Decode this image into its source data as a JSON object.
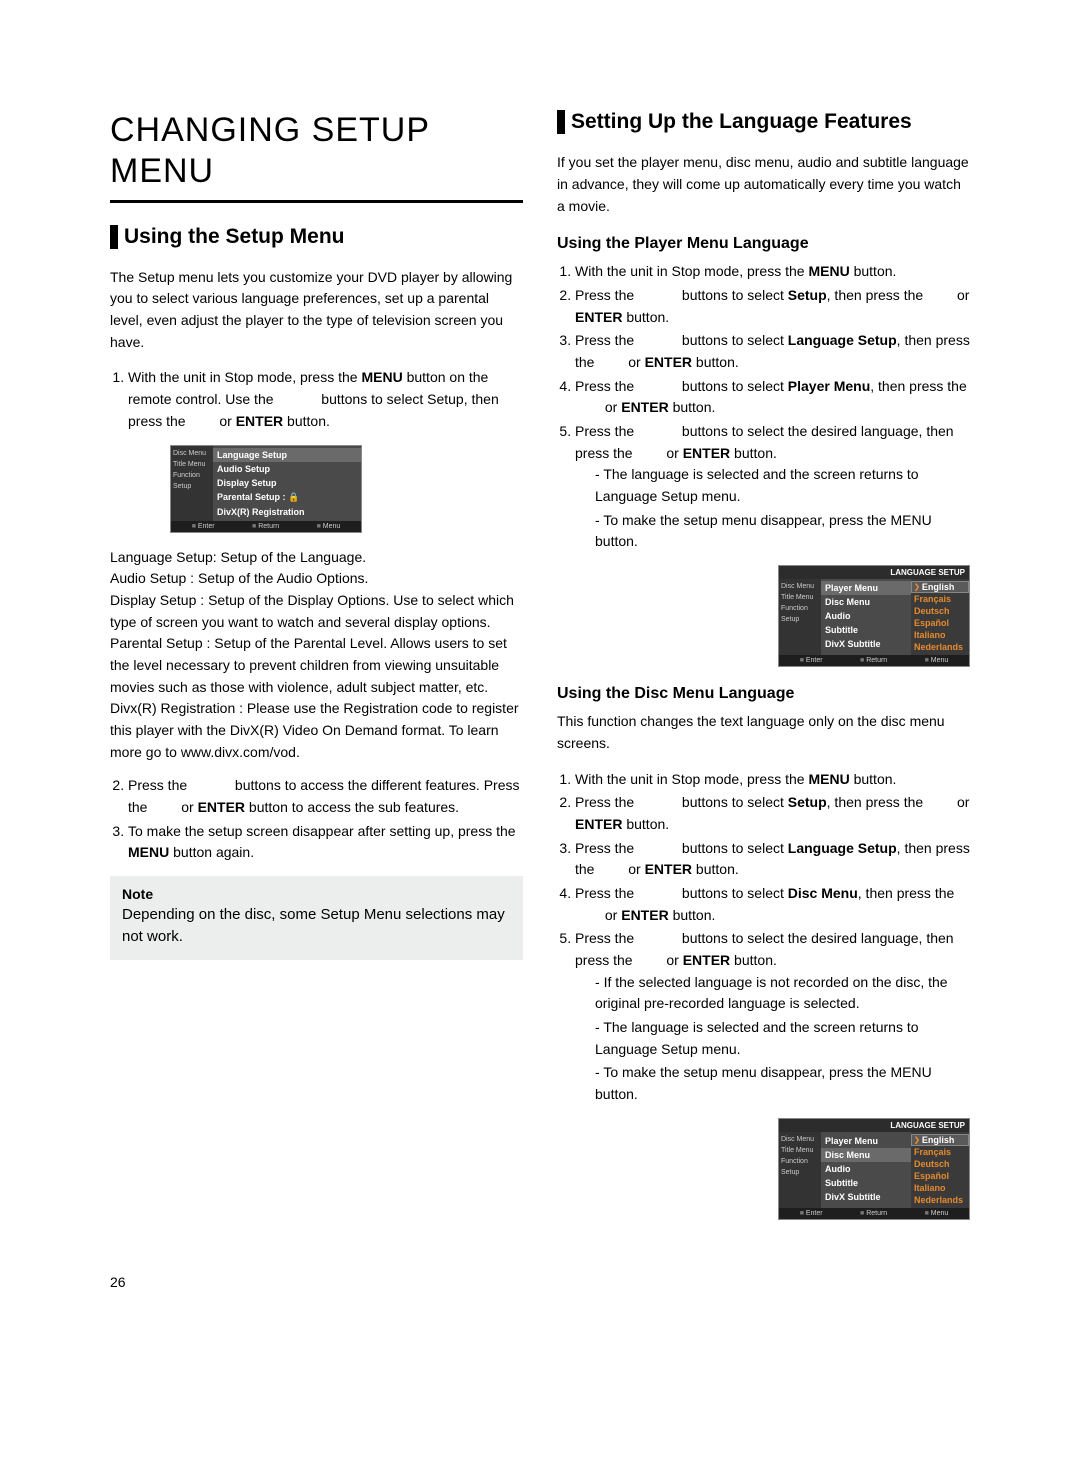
{
  "page_number": "26",
  "left": {
    "main_title": "CHANGING SETUP MENU",
    "section_heading": "Using the Setup Menu",
    "intro": "The Setup menu lets you customize your DVD player by allowing you to select various language preferences, set up a parental level, even adjust the player to the type of television screen you have.",
    "step1_a": "With the unit in Stop mode, press the ",
    "step1_menu": "MENU",
    "step1_b": " button on the remote control.  Use the ",
    "step1_c": " buttons to select Setup, then press the ",
    "step1_d": " or ",
    "step1_enter": "ENTER",
    "step1_e": " button.",
    "osd1": {
      "side": [
        "Disc Menu",
        "Title Menu",
        "Function",
        "Setup"
      ],
      "items": [
        "Language Setup",
        "Audio Setup",
        "Display Setup",
        "Parental Setup :   🔒",
        "DivX(R) Registration"
      ],
      "footer": [
        "Enter",
        "Return",
        "Menu"
      ]
    },
    "defs": {
      "lang_label": "Language Setup: ",
      "lang_body": "Setup of the Language.",
      "audio_label": "Audio Setup : ",
      "audio_body": "Setup of the Audio Options.",
      "display_label": "Display Setup : ",
      "display_body": "Setup of the Display Options. Use to select which type of screen you want to watch and several display options.",
      "parental_label": "Parental Setup : ",
      "parental_body": "Setup of the Parental Level. Allows users to set the level necessary to prevent children from viewing unsuitable movies such as those with violence, adult subject matter, etc.",
      "divx_label": "Divx(R) Registration : ",
      "divx_body": "Please use the Registration code to register this player with the DivX(R) Video On Demand format. To learn more go to www.divx.com/vod."
    },
    "step2_a": "Press the ",
    "step2_b": " buttons to access the different  features. Press the ",
    "step2_c": " or ",
    "step2_enter": "ENTER",
    "step2_d": " button to access the sub features.",
    "step3_a": "To make the setup screen disappear after setting up, press the ",
    "step3_menu": "MENU",
    "step3_b": " button again.",
    "note_title": "Note",
    "note_body": "Depending on the disc, some Setup Menu selections may not work."
  },
  "right": {
    "section_heading": "Setting Up the Language Features",
    "intro": "If you set the player menu, disc menu, audio and subtitle language in advance, they will come up automatically every time you watch a movie.",
    "sub1_heading": "Using the Player Menu Language",
    "s1_1a": "With the unit in Stop mode, press the ",
    "s1_1menu": "MENU",
    "s1_1b": " button.",
    "s1_2a": "Press the ",
    "s1_2b": " buttons to select ",
    "s1_2setup": "Setup",
    "s1_2c": ", then press the ",
    "s1_2d": " or ",
    "s1_2enter": "ENTER",
    "s1_2e": " button.",
    "s1_3a": "Press the ",
    "s1_3b": " buttons to select ",
    "s1_3ls": "Language Setup",
    "s1_3c": ", then press the ",
    "s1_3d": " or ",
    "s1_3enter": "ENTER",
    "s1_3e": " button.",
    "s1_4a": "Press the ",
    "s1_4b": " buttons to select ",
    "s1_4pm": "Player Menu",
    "s1_4c": ", then press the ",
    "s1_4d": " or ",
    "s1_4enter": "ENTER",
    "s1_4e": " button.",
    "s1_5a": "Press the ",
    "s1_5b": " buttons to select the desired language, then press the ",
    "s1_5c": " or ",
    "s1_5enter": "ENTER",
    "s1_5d": " button.",
    "s1_note1": "The language is selected and the screen returns to Language Setup menu.",
    "s1_note2": "To make the setup menu disappear, press the MENU button.",
    "osd2": {
      "title": "LANGUAGE SETUP",
      "side": [
        "Disc Menu",
        "Title Menu",
        "Function",
        "Setup"
      ],
      "mid": [
        "Player Menu",
        "Disc Menu",
        "Audio",
        "Subtitle",
        "DivX Subtitle"
      ],
      "right": [
        "English",
        "Français",
        "Deutsch",
        "Español",
        "Italiano",
        "Nederlands"
      ],
      "footer": [
        "Enter",
        "Return",
        "Menu"
      ]
    },
    "sub2_heading": "Using the Disc Menu Language",
    "s2_intro": "This function changes the text language only on the disc menu screens.",
    "s2_1a": "With the unit in Stop mode, press the ",
    "s2_1menu": "MENU",
    "s2_1b": " button.",
    "s2_2a": "Press the ",
    "s2_2b": " buttons to select ",
    "s2_2setup": "Setup",
    "s2_2c": ", then press the ",
    "s2_2d": " or ",
    "s2_2enter": "ENTER",
    "s2_2e": " button.",
    "s2_3a": "Press the ",
    "s2_3b": " buttons to select ",
    "s2_3ls": "Language Setup",
    "s2_3c": ", then press the ",
    "s2_3d": " or ",
    "s2_3enter": "ENTER",
    "s2_3e": " button.",
    "s2_4a": "Press the ",
    "s2_4b": " buttons to select ",
    "s2_4dm": "Disc Menu",
    "s2_4c": ", then press the ",
    "s2_4d": " or ",
    "s2_4enter": "ENTER",
    "s2_4e": "  button.",
    "s2_5a": "Press the ",
    "s2_5b": " buttons to select the desired    language, then press the ",
    "s2_5c": " or ",
    "s2_5enter": "ENTER",
    "s2_5d": " button.",
    "s2_note0": "If the selected language is not recorded on  the disc, the original pre-recorded language is selected.",
    "s2_note1": "The language is selected and the screen returns to Language Setup menu.",
    "s2_note2": "To make the setup menu disappear, press the MENU button.",
    "osd3": {
      "title": "LANGUAGE SETUP",
      "side": [
        "Disc Menu",
        "Title Menu",
        "Function",
        "Setup"
      ],
      "mid": [
        "Player Menu",
        "Disc Menu",
        "Audio",
        "Subtitle",
        "DivX Subtitle"
      ],
      "right": [
        "English",
        "Français",
        "Deutsch",
        "Español",
        "Italiano",
        "Nederlands"
      ],
      "footer": [
        "Enter",
        "Return",
        "Menu"
      ]
    }
  }
}
